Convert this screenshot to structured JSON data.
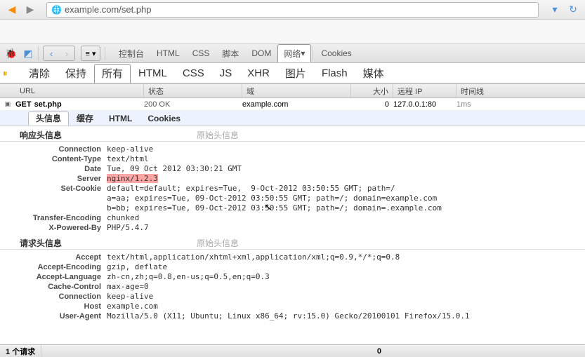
{
  "browser": {
    "url": "example.com/set.php"
  },
  "firebug": {
    "tabs": {
      "console": "控制台",
      "html": "HTML",
      "css": "CSS",
      "script": "脚本",
      "dom": "DOM",
      "net": "网络",
      "cookies": "Cookies"
    }
  },
  "netToolbar": {
    "clear": "清除",
    "persist": "保持",
    "all": "所有",
    "html": "HTML",
    "css": "CSS",
    "js": "JS",
    "xhr": "XHR",
    "images": "图片",
    "flash": "Flash",
    "media": "媒体"
  },
  "columns": {
    "url": "URL",
    "status": "状态",
    "domain": "域",
    "size": "大小",
    "remoteIp": "远程 IP",
    "timeline": "时间线"
  },
  "request": {
    "method": "GET",
    "file": "set.php",
    "status": "200 OK",
    "domain": "example.com",
    "size": "0",
    "remoteIp": "127.0.0.1:80",
    "time": "1ms"
  },
  "innerTabs": {
    "headers": "头信息",
    "cache": "缓存",
    "html": "HTML",
    "cookies": "Cookies"
  },
  "responseGroup": {
    "title": "响应头信息",
    "raw": "原始头信息"
  },
  "requestGroup": {
    "title": "请求头信息",
    "raw": "原始头信息"
  },
  "responseHeaders": {
    "Connection": "keep-alive",
    "Content-Type": "text/html",
    "Date": "Tue, 09 Oct 2012 03:30:21 GMT",
    "Server": "nginx/1.2.3",
    "Set-Cookie": "default=default; expires=Tue,  9-Oct-2012 03:50:55 GMT; path=/\na=aa; expires=Tue, 09-Oct-2012 03:50:55 GMT; path=/; domain=example.com\nb=bb; expires=Tue, 09-Oct-2012 03:50:55 GMT; path=/; domain=.example.com",
    "Transfer-Encoding": "chunked",
    "X-Powered-By": "PHP/5.4.7"
  },
  "requestHeaders": {
    "Accept": "text/html,application/xhtml+xml,application/xml;q=0.9,*/*;q=0.8",
    "Accept-Encoding": "gzip, deflate",
    "Accept-Language": "zh-cn,zh;q=0.8,en-us;q=0.5,en;q=0.3",
    "Cache-Control": "max-age=0",
    "Connection": "keep-alive",
    "Host": "example.com",
    "User-Agent": "Mozilla/5.0 (X11; Ubuntu; Linux x86_64; rv:15.0) Gecko/20100101 Firefox/15.0.1"
  },
  "statusBar": {
    "requests": "1 个请求",
    "size": "0"
  }
}
